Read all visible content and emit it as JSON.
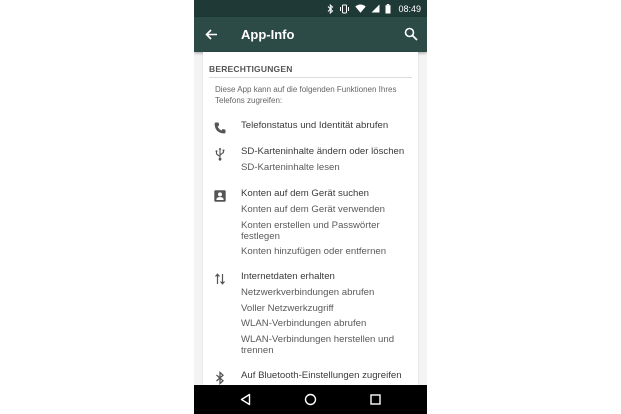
{
  "status_bar": {
    "time": "08:49",
    "icons": [
      "bluetooth-icon",
      "vibrate-icon",
      "wifi-icon",
      "signal-icon",
      "battery-icon"
    ]
  },
  "app_bar": {
    "title": "App-Info",
    "back_icon": "arrow-back-icon",
    "search_icon": "search-icon",
    "color": "#2c4a46"
  },
  "section": {
    "header": "BERECHTIGUNGEN",
    "intro": "Diese App kann auf die folgenden Funktionen Ihres Telefons zugreifen:"
  },
  "groups": [
    {
      "icon": "phone-icon",
      "items": [
        "Telefonstatus und Identität abrufen"
      ]
    },
    {
      "icon": "usb-icon",
      "items": [
        "SD-Karteninhalte ändern oder löschen",
        "SD-Karteninhalte lesen"
      ]
    },
    {
      "icon": "contact-icon",
      "items": [
        "Konten auf dem Gerät suchen",
        "Konten auf dem Gerät verwenden",
        "Konten erstellen und Passwörter",
        "festlegen",
        "Konten hinzufügen oder entfernen"
      ]
    },
    {
      "icon": "swap-vertical-icon",
      "items": [
        "Internetdaten erhalten",
        "Netzwerkverbindungen abrufen",
        "Voller Netzwerkzugriff",
        "WLAN-Verbindungen abrufen",
        "WLAN-Verbindungen herstellen und",
        "trennen"
      ]
    },
    {
      "icon": "bluetooth-icon",
      "items": [
        "Auf Bluetooth-Einstellungen zugreifen"
      ]
    }
  ],
  "nav_bar": {
    "icons": [
      "back-nav-icon",
      "home-nav-icon",
      "recents-nav-icon"
    ]
  }
}
